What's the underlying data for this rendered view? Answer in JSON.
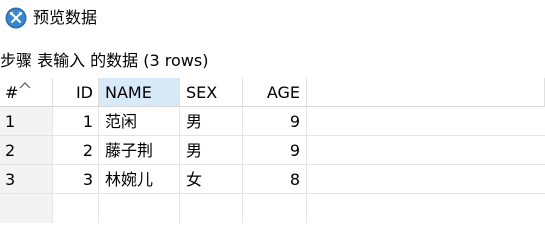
{
  "window": {
    "title": "预览数据",
    "icon": "spoon-fork-tool-icon"
  },
  "caption": "步骤 表输入 的数据  (3 rows)",
  "table": {
    "columns": [
      "#",
      "ID",
      "NAME",
      "SEX",
      "AGE"
    ],
    "sorted_column": "NAME",
    "rows": [
      {
        "num": "1",
        "id": "1",
        "name": "范闲",
        "sex": "男",
        "age": "9"
      },
      {
        "num": "2",
        "id": "2",
        "name": "藤子荆",
        "sex": "男",
        "age": "9"
      },
      {
        "num": "3",
        "id": "3",
        "name": "林婉儿",
        "sex": "女",
        "age": "8"
      }
    ]
  },
  "colors": {
    "header_selected": "#d8e9f8",
    "row_number_bg": "#f3f3f3",
    "grid_line": "#e4e4e4"
  }
}
